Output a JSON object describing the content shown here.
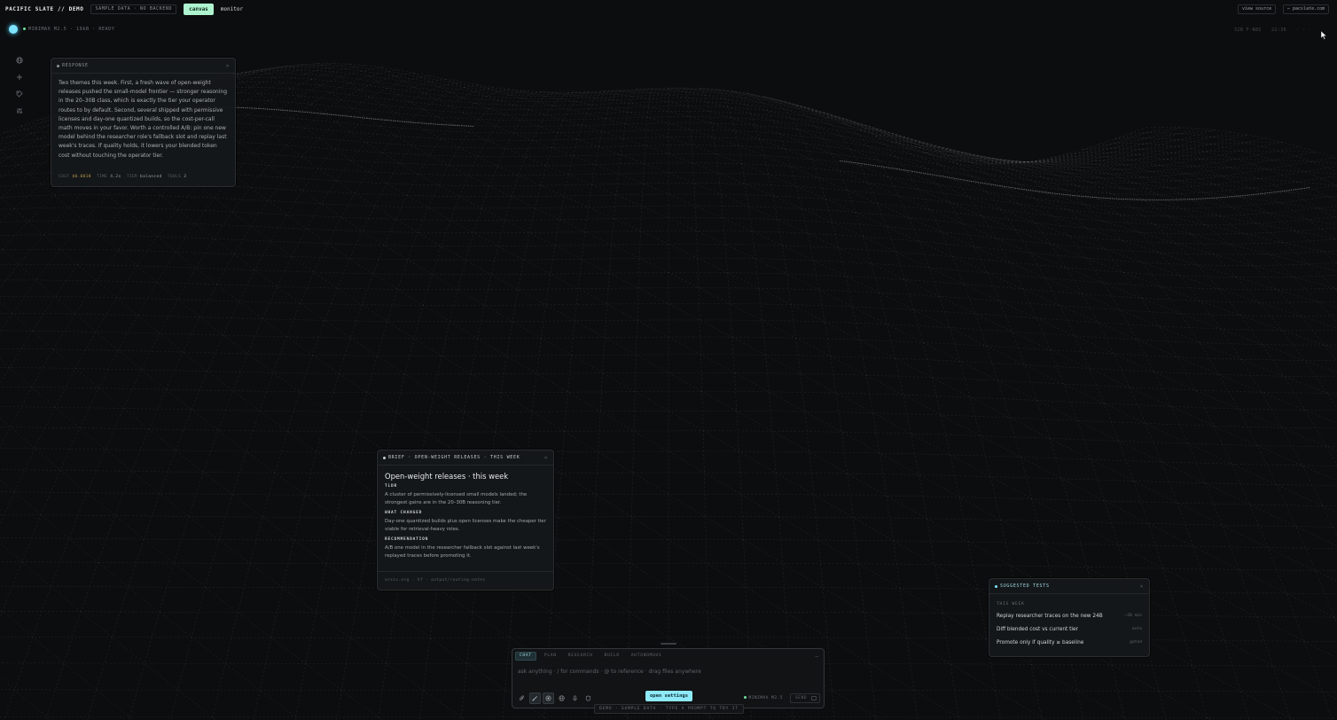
{
  "topbar": {
    "brand": "PACIFIC SLATE // DEMO",
    "sample_badge": "SAMPLE DATA · NO BACKEND",
    "tab_canvas": "canvas",
    "tab_monitor": "monitor",
    "view_source": "view source",
    "site_link": "← pacslate.com"
  },
  "status": {
    "text": "MINIMAX M2.5 · 19kB · READY",
    "right_a": "32B F-N8S",
    "right_b": "22:36",
    "right_c": "· · ·"
  },
  "sidebar": {
    "icons": [
      "globe-icon",
      "plus-icon",
      "tag-icon",
      "sliders-icon"
    ]
  },
  "response_panel": {
    "title": "RESPONSE",
    "close": "×",
    "body": "Two themes this week. First, a fresh wave of open-weight releases pushed the small-model frontier — stronger reasoning in the 20–30B class, which is exactly the tier your operator routes to by default. Second, several shipped with permissive licenses and day-one quantized builds, so the cost-per-call math moves in your favor. Worth a controlled A/B: pin one new model behind the researcher role's fallback slot and replay last week's traces. If quality holds, it lowers your blended token cost without touching the operator tier.",
    "meta": {
      "cost_label": "COST",
      "cost_value": "$0.0018",
      "time_label": "TIME",
      "time_value": "4.2s",
      "tier_label": "TIER",
      "tier_value": "balanced",
      "tools_label": "TOOLS",
      "tools_value": "3"
    }
  },
  "brief_panel": {
    "header": "BRIEF · OPEN-WEIGHT RELEASES · THIS WEEK",
    "close": "×",
    "title": "Open-weight releases · this week",
    "sections": [
      {
        "heading": "TLDR",
        "text": "A cluster of permissively-licensed small models landed; the strongest gains are in the 20–30B reasoning tier."
      },
      {
        "heading": "WHAT CHANGED",
        "text": "Day-one quantized builds plus open licenses make the cheaper tier viable for retrieval-heavy roles."
      },
      {
        "heading": "RECOMMENDATION",
        "text": "A/B one model in the researcher fallback slot against last week's replayed traces before promoting it."
      }
    ],
    "sources": "arxiv.org · hf · output/routing-notes"
  },
  "suggested_panel": {
    "header": "SUGGESTED TESTS",
    "close": "×",
    "category": "THIS WEEK",
    "items": [
      {
        "label": "Replay researcher traces on the new 24B",
        "tag": "~20 min"
      },
      {
        "label": "Diff blended cost vs current tier",
        "tag": "auto"
      },
      {
        "label": "Promote only if quality ≥ baseline",
        "tag": "gated"
      }
    ]
  },
  "composer": {
    "tabs": [
      "CHAT",
      "PLAN",
      "RESEARCH",
      "BUILD",
      "AUTONOMOUS"
    ],
    "more": "—",
    "placeholder": "ask anything · / for commands · @ to reference · drag files anywhere",
    "tools": [
      "attach-icon",
      "brush-icon",
      "target-icon",
      "globe-icon",
      "mic-icon",
      "shield-icon"
    ],
    "model": "MINIMAX M2.5",
    "send": "SEND",
    "open_settings": "open settings",
    "demo_hint": "DEMO · SAMPLE DATA · TYPE A PROMPT TO TRY IT"
  },
  "colors": {
    "accent_mint": "#aef3cf",
    "accent_cyan": "#8eeaf8",
    "orb": "#7fe4ff",
    "background": "#0c0d0e"
  }
}
